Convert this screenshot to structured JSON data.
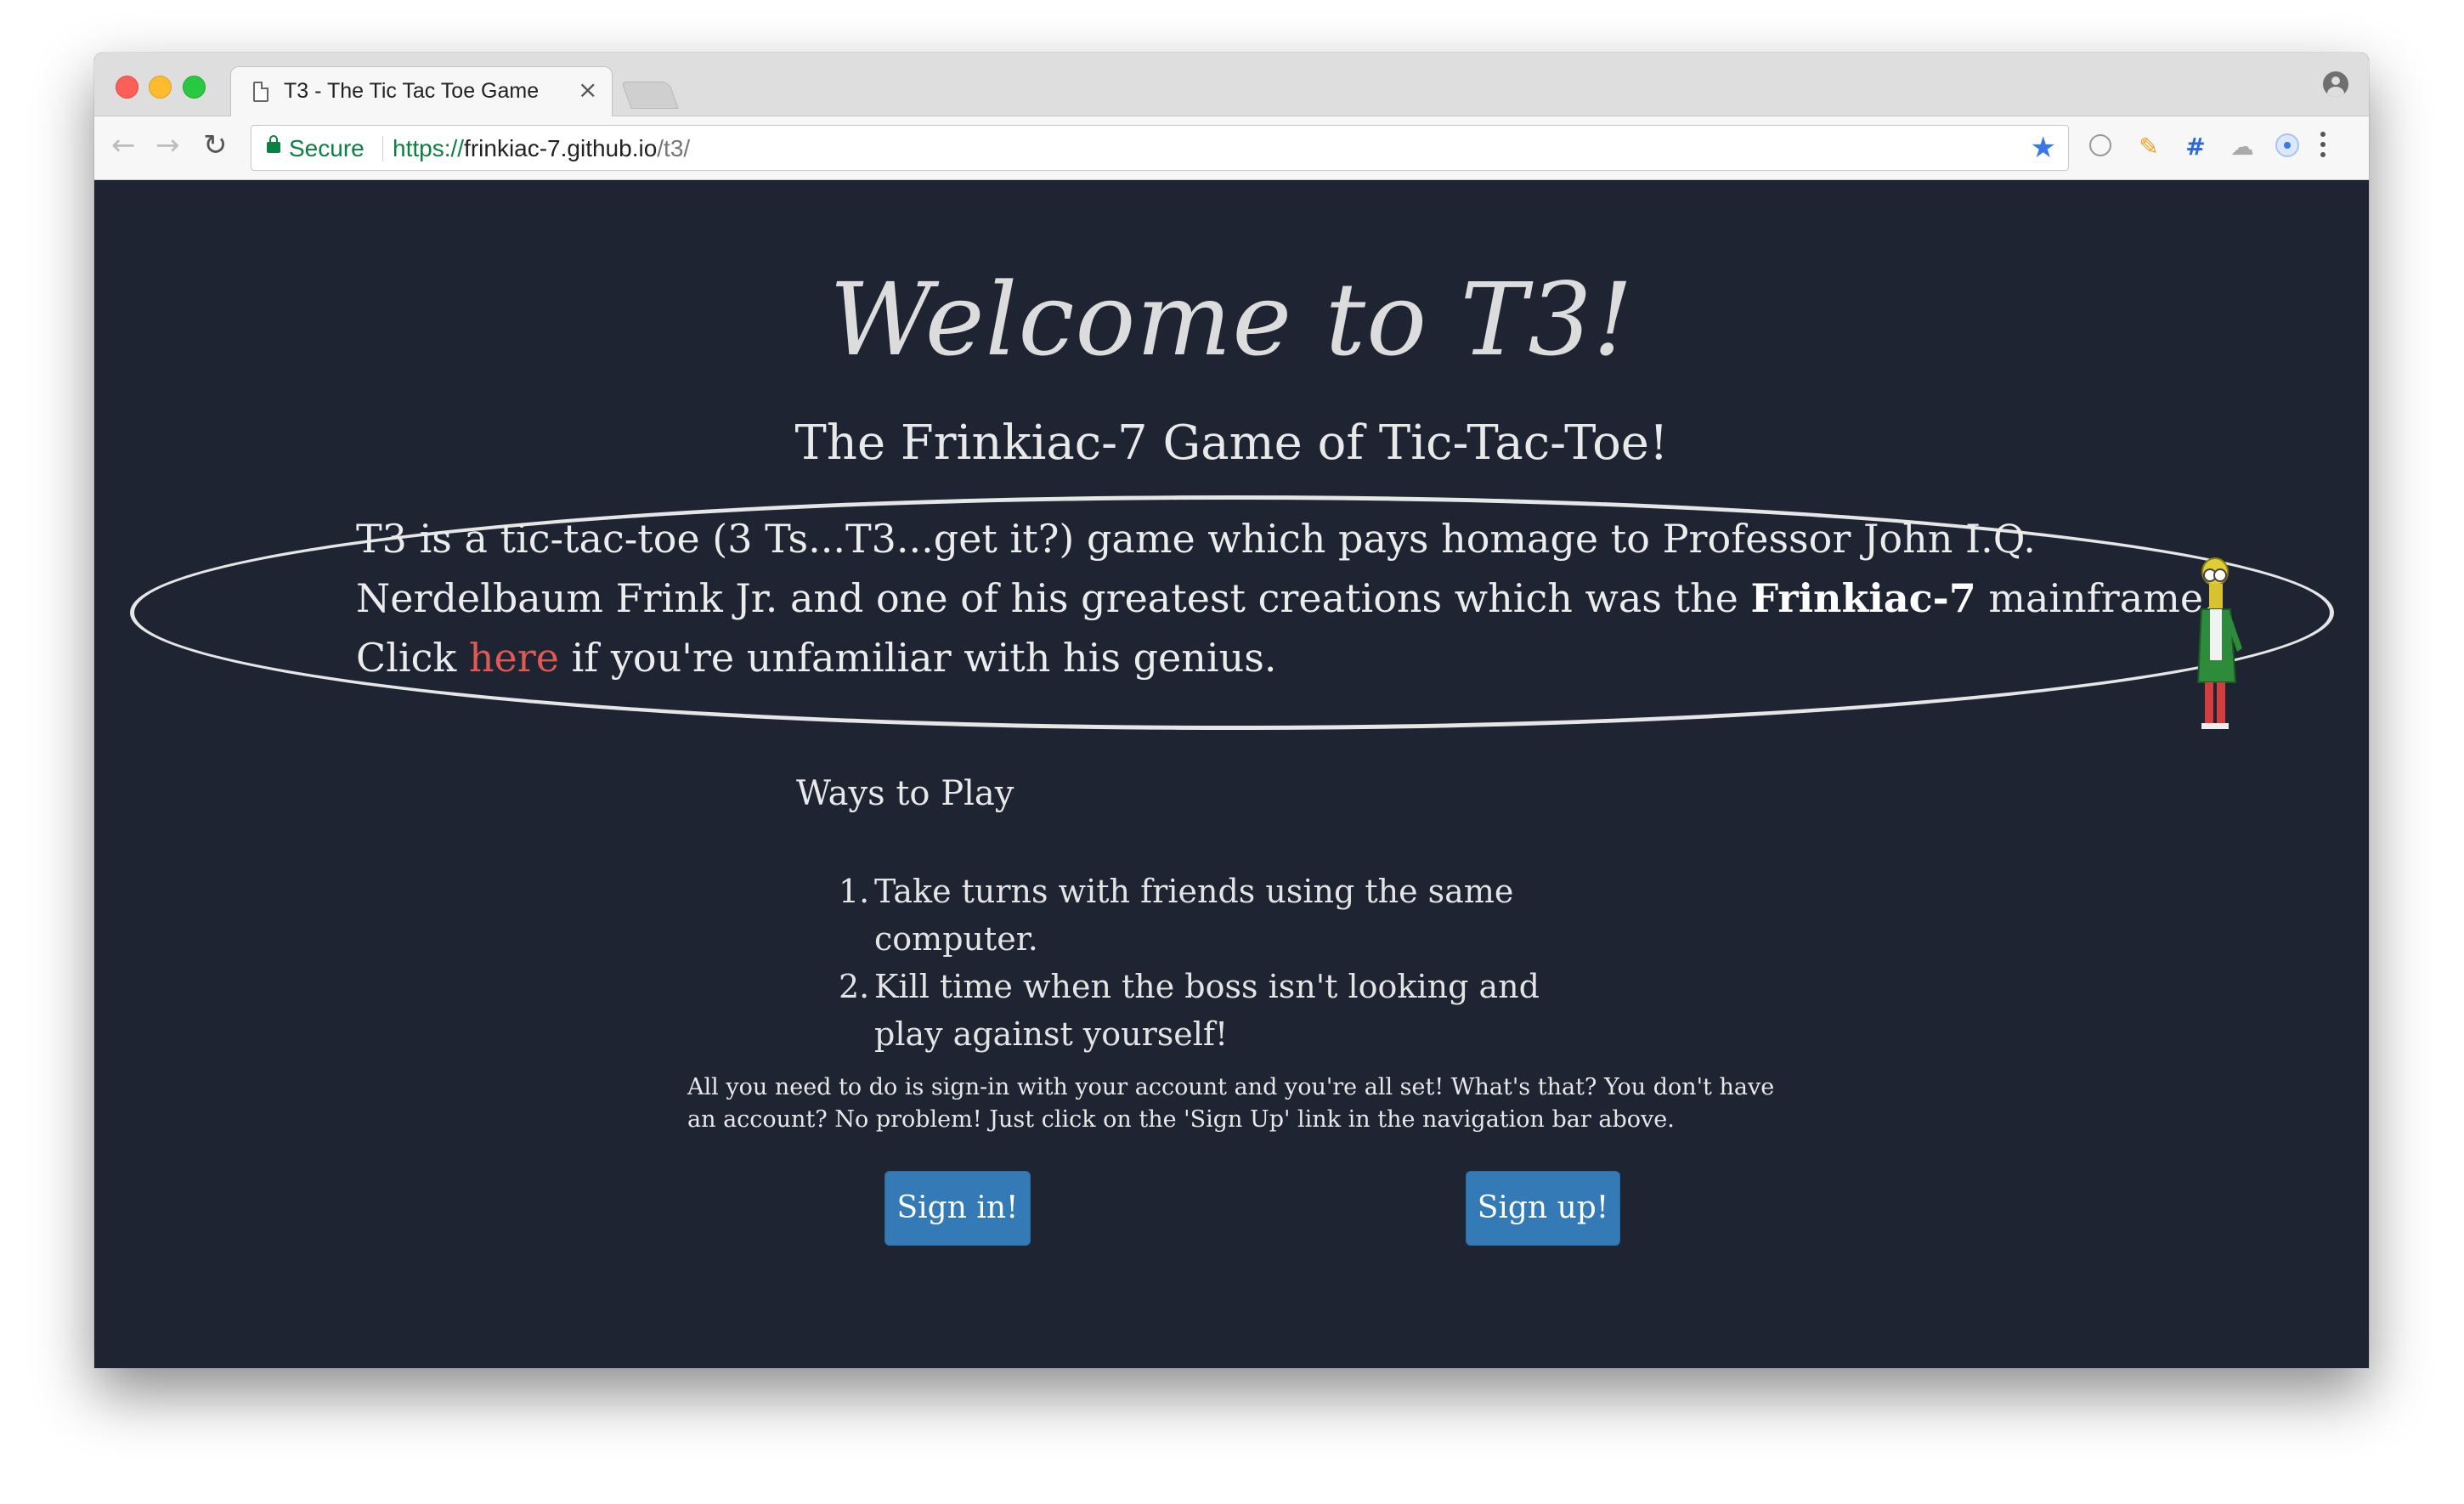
{
  "browser": {
    "tab_title": "T3 - The Tic Tac Toe Game",
    "tab_close": "×",
    "secure_label": "Secure",
    "url_scheme": "https://",
    "url_host": "frinkiac-7.github.io",
    "url_path": "/t3/"
  },
  "page": {
    "heading": "Welcome to T3!",
    "subheading": "The Frinkiac-7 Game of Tic-Tac-Toe!",
    "intro_before": "T3 is a tic-tac-toe (3 Ts...T3...get it?) game which pays homage to Professor John I.Q. Nerdelbaum Frink Jr. and one of his greatest creations which was the ",
    "intro_bold": "Frinkiac-7",
    "intro_middle": " mainframe. Click ",
    "intro_link": "here",
    "intro_after": " if you're unfamiliar with his genius.",
    "ways_title": "Ways to Play",
    "ways": [
      {
        "num": "1.",
        "text": "Take turns with friends using the same computer."
      },
      {
        "num": "2.",
        "text": "Kill time when the boss isn't looking and play against yourself!"
      }
    ],
    "info": "All you need to do is sign-in with your account and you're all set! What's that? You don't have an account? No problem! Just click on the 'Sign Up' link in the navigation bar above.",
    "signin_label": "Sign in!",
    "signup_label": "Sign up!"
  },
  "colors": {
    "page_background": "#1e2432",
    "link": "#e05a55",
    "button": "#337ab7"
  }
}
